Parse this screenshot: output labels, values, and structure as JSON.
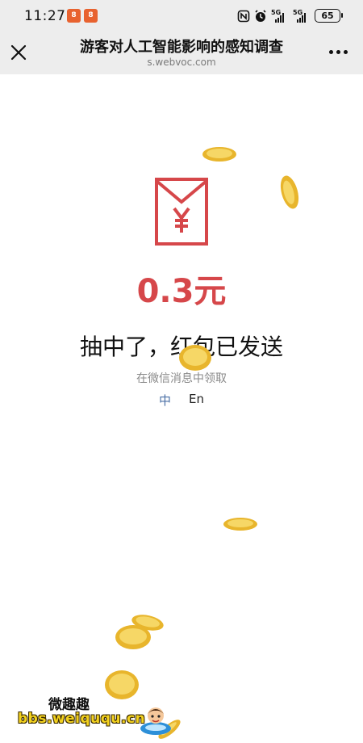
{
  "status_bar": {
    "time": "11:27",
    "app_badges": [
      "app-badge-icon",
      "app-badge-icon"
    ],
    "icons": [
      "nfc-icon",
      "alarm-icon",
      "5g-signal-icon",
      "5g-signal-icon",
      "battery-icon"
    ],
    "network_label": "5G",
    "battery": "65"
  },
  "nav": {
    "title": "游客对人工智能影响的感知调查",
    "subtitle": "s.webvoc.com",
    "close_icon": "close-icon",
    "more_icon": "more-dots-icon"
  },
  "result": {
    "envelope_icon": "red-envelope-icon",
    "amount": "0.3元",
    "headline": "抽中了，红包已发送",
    "subtext": "在微信消息中领取",
    "lang_zh": "中",
    "lang_en": "En",
    "accent_color": "#d6474a"
  },
  "decor": {
    "coin_icon": "gold-coin-icon"
  },
  "watermark": {
    "title": "微趣趣",
    "url": "bbs.weiququ.cn"
  }
}
